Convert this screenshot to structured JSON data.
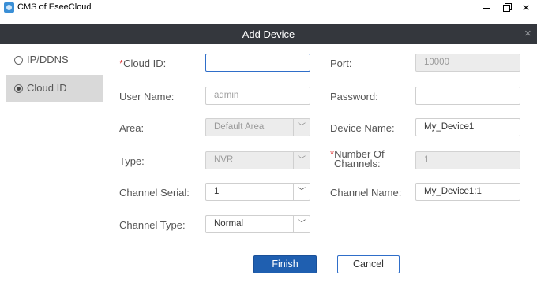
{
  "window": {
    "title": "CMS of EseeCloud"
  },
  "dialog": {
    "title": "Add Device",
    "close_glyph": "×"
  },
  "sidebar": {
    "items": [
      {
        "label": "IP/DDNS",
        "selected": false
      },
      {
        "label": "Cloud ID",
        "selected": true
      }
    ]
  },
  "form": {
    "cloud_id": {
      "required_mark": "*",
      "label": "Cloud ID:",
      "value": ""
    },
    "port": {
      "label": "Port:",
      "value": "10000"
    },
    "user_name": {
      "label": "User Name:",
      "value": "",
      "placeholder": "admin"
    },
    "password": {
      "label": "Password:",
      "value": ""
    },
    "area": {
      "label": "Area:",
      "value": "Default Area"
    },
    "device_name": {
      "label": "Device Name:",
      "value": "My_Device1"
    },
    "type": {
      "label": "Type:",
      "value": "NVR"
    },
    "num_channels": {
      "required_mark": "*",
      "label_line1": "Number Of",
      "label_line2": "Channels:",
      "value": "1"
    },
    "channel_serial": {
      "label": "Channel Serial:",
      "value": "1"
    },
    "channel_name": {
      "label": "Channel Name:",
      "value": "My_Device1:1"
    },
    "channel_type": {
      "label": "Channel Type:",
      "value": "Normal"
    }
  },
  "buttons": {
    "finish": "Finish",
    "cancel": "Cancel"
  },
  "colors": {
    "header_bg": "#34373d",
    "primary": "#1f5fb0",
    "required": "#e04040",
    "focus_border": "#2f6ec9"
  }
}
